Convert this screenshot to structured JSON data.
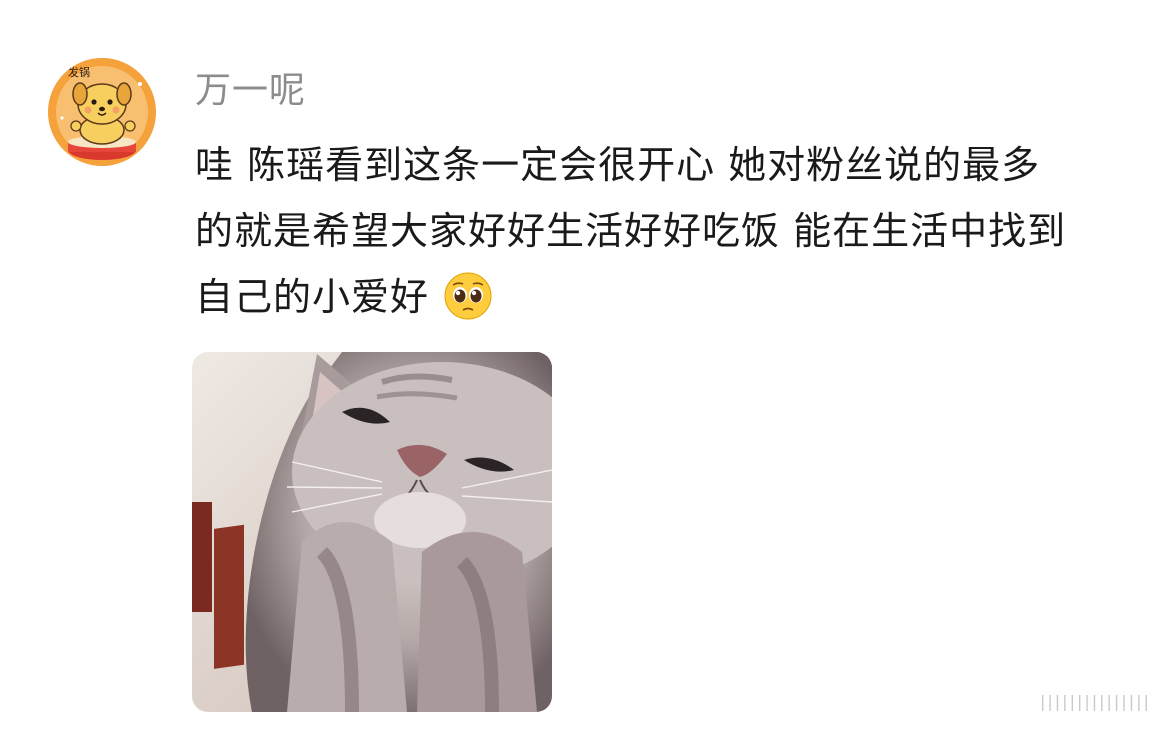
{
  "comment": {
    "username": "万一呢",
    "text_lines": [
      "哇 陈瑶看到这条一定会很开心 她对粉丝说的最多",
      "的就是希望大家好好生活好好吃饭 能在生活中找到",
      "自己的小爱好"
    ],
    "avatar_badge_text": "发锅",
    "emoji": "pleading-face-emoji",
    "attached_image": "cat-photo",
    "watermark": "|||||||||||||||"
  },
  "colors": {
    "username": "#8c8c8c",
    "text": "#1a1a1a",
    "avatar_bg": "#f6a23c"
  }
}
